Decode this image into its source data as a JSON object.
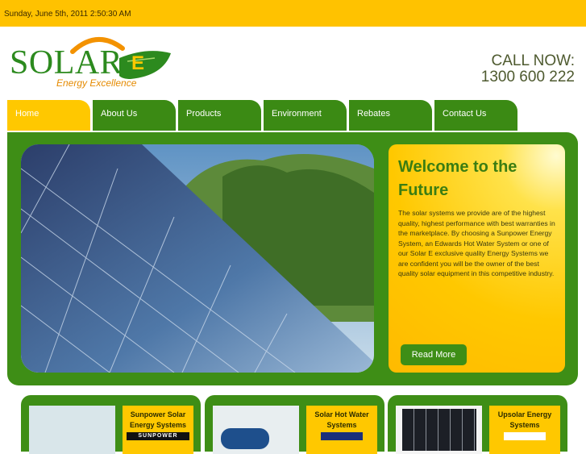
{
  "topbar": {
    "date": "Sunday, June 5th, 2011 2:50:30 AM"
  },
  "logo": {
    "name_main": "SOLAR",
    "name_letter": "E",
    "tagline": "Energy Excellence"
  },
  "contact": {
    "line1": "CALL NOW:",
    "line2": "1300 600 222"
  },
  "nav": {
    "items": [
      {
        "label": "Home"
      },
      {
        "label": "About Us"
      },
      {
        "label": "Products"
      },
      {
        "label": "Environment"
      },
      {
        "label": "Rebates"
      },
      {
        "label": "Contact Us"
      }
    ]
  },
  "welcome": {
    "title": "Welcome to the Future",
    "body": "The solar systems we provide are of the highest quality, highest performance with best warranties in the marketplace. By choosing a Sunpower Energy System, an Edwards Hot Water System or one of our Solar E exclusive quality Energy Systems we are confident you will be the owner of the best quality solar equipment in this competitive industry.",
    "button": "Read More"
  },
  "products": [
    {
      "label": "Sunpower Solar Energy Systems",
      "brand": "SUNPOWER"
    },
    {
      "label": "Solar Hot Water Systems",
      "brand": ""
    },
    {
      "label": "Upsolar Energy Systems",
      "brand": ""
    }
  ],
  "colors": {
    "accent_green": "#3e8e16",
    "accent_yellow": "#ffc800"
  }
}
